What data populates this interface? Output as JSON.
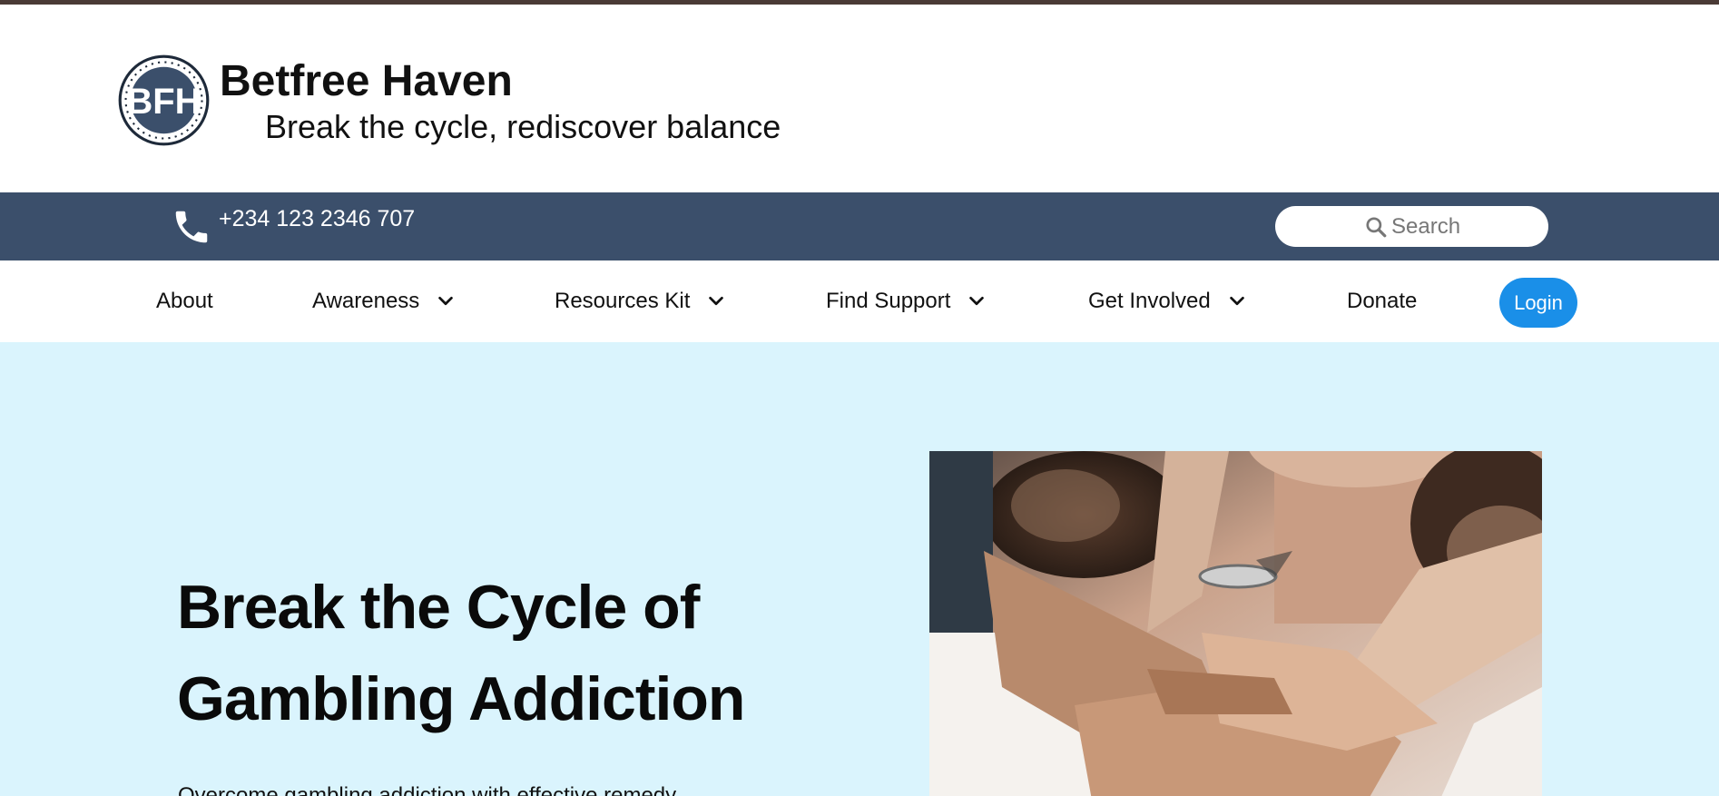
{
  "brand": {
    "logo_alt": "BFH",
    "title": "Betfree Haven",
    "tagline": "Break the cycle, rediscover balance"
  },
  "contact": {
    "phone": "+234 123 2346 707",
    "phone_icon": "phone-icon"
  },
  "search": {
    "placeholder": "Search",
    "icon": "search-icon"
  },
  "nav": {
    "items": [
      {
        "label": "About",
        "has_dropdown": false
      },
      {
        "label": "Awareness",
        "has_dropdown": true
      },
      {
        "label": "Resources Kit",
        "has_dropdown": true
      },
      {
        "label": "Find Support",
        "has_dropdown": true
      },
      {
        "label": "Get Involved",
        "has_dropdown": true
      },
      {
        "label": "Donate",
        "has_dropdown": false
      }
    ],
    "login_label": "Login"
  },
  "hero": {
    "title_line1": "Break the Cycle of",
    "title_line2": "Gambling Addiction",
    "text": "Overcome gambling addiction with effective remedy"
  },
  "colors": {
    "top_strip": "#4a3a36",
    "contact_bar": "#3b4f6b",
    "hero_bg": "#daf4fd",
    "login_button": "#1a8fe8"
  }
}
